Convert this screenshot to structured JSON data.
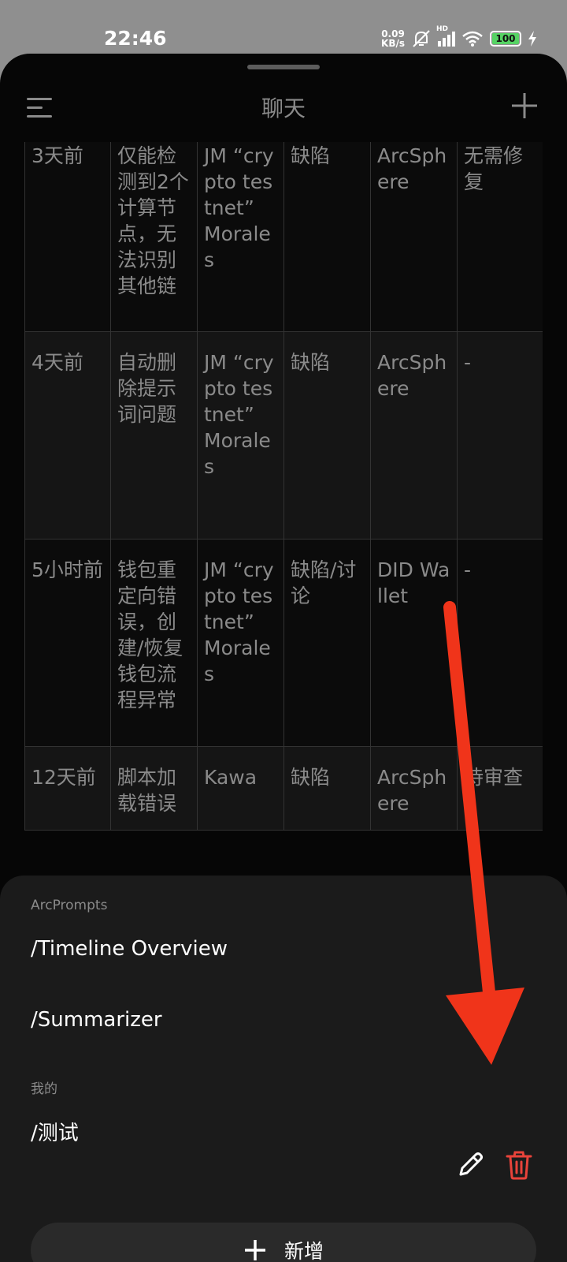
{
  "status_bar": {
    "time": "22:46",
    "net_speed_value": "0.09",
    "net_speed_unit": "KB/s",
    "hd_label": "HD",
    "battery": "100",
    "icons": [
      "mute-bell-icon",
      "cellular-signal-icon",
      "wifi-icon",
      "battery-icon",
      "charging-icon"
    ]
  },
  "header": {
    "title": "聊天",
    "menu_icon": "menu-icon",
    "add_icon": "plus-icon"
  },
  "table": {
    "rows": [
      [
        "3天前",
        "仅能检测到2个计算节点，无法识别其他链",
        "JM “crypto testnet” Morales",
        "缺陷",
        "ArcSphere",
        "无需修复"
      ],
      [
        "4天前",
        "自动删除提示词问题",
        "JM “crypto testnet” Morales",
        "缺陷",
        "ArcSphere",
        "-"
      ],
      [
        "5小时前",
        "钱包重定向错误，创建/恢复钱包流程异常",
        "JM “crypto testnet” Morales",
        "缺陷/讨论",
        "DID Wallet",
        "-"
      ],
      [
        "12天前",
        "脚本加载错误",
        "Kawa",
        "缺陷",
        "ArcSphere",
        "待审查"
      ]
    ]
  },
  "panel": {
    "section1_label": "ArcPrompts",
    "section1_items": [
      "/Timeline Overview",
      "/Summarizer"
    ],
    "section2_label": "我的",
    "section2_items": [
      "/测试"
    ],
    "edit_icon": "pencil-icon",
    "delete_icon": "trash-icon",
    "new_button_label": "新增",
    "accent_delete": "#e8433a"
  },
  "annotation": {
    "arrow_color": "#f0341a"
  }
}
